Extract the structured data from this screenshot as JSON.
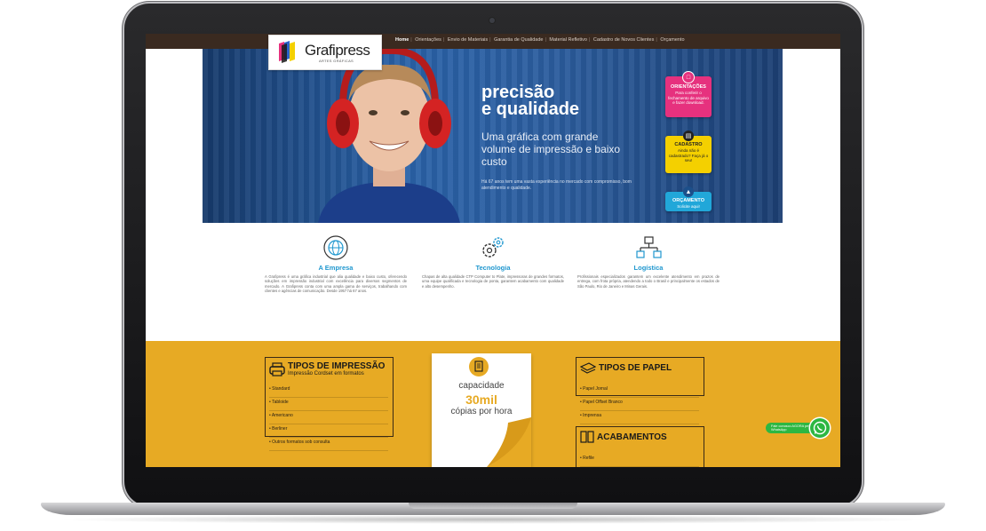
{
  "colors": {
    "nav_bg": "#3a2a20",
    "accent_blue": "#1f97cf",
    "accent_yellow": "#e7aa24",
    "pink": "#e6317e",
    "yellow_card": "#f4d000",
    "blue_card": "#21a7d9",
    "whatsapp": "#2db742"
  },
  "logo": {
    "name": "Grafipress",
    "sub": "ARTES GRÁFICAS"
  },
  "nav": {
    "items": [
      "Home",
      "Orientações",
      "Envio de Materiais",
      "Garantia de Qualidade",
      "Material Refletivo",
      "Cadastro de Novos Clientes",
      "Orçamento"
    ]
  },
  "hero": {
    "title_line1": "precisão",
    "title_line2": "e qualidade",
    "subtitle": "Uma gráfica com grande volume de impressão e baixo custo",
    "small": "Há 67 anos tem uma vasta experiência no mercado com compromisso, bom atendimento e qualidade.",
    "cards": [
      {
        "title": "ORIENTAÇÕES",
        "body": "Para conferir o fechamento de arquivo e fazer download.",
        "icon": "document-icon"
      },
      {
        "title": "CADASTRO",
        "body": "Ainda não é cadastrado? Faça já o seu!",
        "icon": "clipboard-icon"
      },
      {
        "title": "ORÇAMENTO",
        "body": "Solicite aqui!",
        "icon": "shopping-cart-icon"
      }
    ]
  },
  "features": [
    {
      "title": "A Empresa",
      "icon": "globe-icon",
      "text": "A Grafipress é uma gráfica industrial que alia qualidade e baixo custo, oferecendo soluções em impressão industrial com excelência para diversos segmentos de mercado. A Grafipress conta com uma ampla gama de serviços, trabalhando com clientes e agências de comunicação. Desde 1957 há 67 anos."
    },
    {
      "title": "Tecnologia",
      "icon": "gears-icon",
      "text": "Chapas de alta qualidade CTP Computer to Plate, impressoras de grandes formatos, uma equipe qualificada e tecnologia de ponta, garantem acabamento com qualidade e alto desempenho."
    },
    {
      "title": "Logística",
      "icon": "network-icon",
      "text": "Profissionais especializados garantem um excelente atendimento em prazos de entrega, com frota própria, atendendo a todo o Brasil e principalmente os estados de São Paulo, Rio de Janeiro e Minas Gerais."
    }
  ],
  "tipos_impressao": {
    "title": "TIPOS DE IMPRESSÃO",
    "subtitle": "Impressão Cordset em formatos",
    "icon": "printer-icon",
    "items": [
      "Standard",
      "Tabloide",
      "Americano",
      "Berliner",
      "Outros formatos sob consulta"
    ]
  },
  "paper_promo": {
    "line1": "capacidade",
    "line2": "30mil",
    "line3": "cópias por hora",
    "icon": "document-icon"
  },
  "tipos_papel": {
    "title": "TIPOS DE PAPEL",
    "icon": "paper-stack-icon",
    "items": [
      "Papel Jornal",
      "Papel Offset Branco",
      "Imprensa"
    ]
  },
  "acabamentos": {
    "title": "ACABAMENTOS",
    "icon": "book-icon",
    "items": [
      "Refile"
    ]
  },
  "whatsapp": {
    "label": "Fale conosco AGORA pelo WhatsApp"
  }
}
